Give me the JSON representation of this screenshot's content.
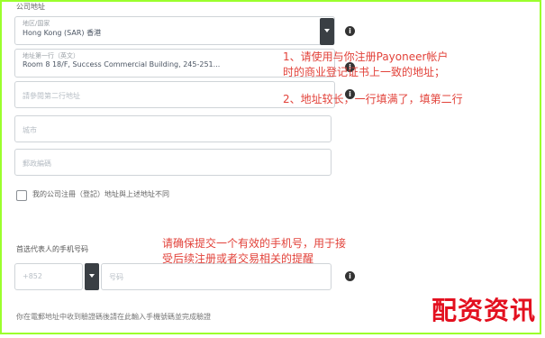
{
  "form": {
    "section_title": "公司地址",
    "region": {
      "label": "地区/国家",
      "value": "Hong Kong (SAR) 香港"
    },
    "address1": {
      "label": "地址第一行（英文）",
      "value": "Room 8 18/F, Success Commercial Building, 245-251..."
    },
    "address2": {
      "placeholder": "請參閱第二行地址"
    },
    "city": {
      "placeholder": "城市"
    },
    "postcode": {
      "placeholder": "郵政編碼"
    },
    "checkbox_label": "我的公司注冊（登記）地址與上述地址不同",
    "phone": {
      "label": "首选代表人的手机号码",
      "code": "+852",
      "placeholder": "号码"
    },
    "bottom_text": "你在電郵地址中收到驗證碼後請在此輸入手機號碼並完成驗證"
  },
  "notes": {
    "note1_line1": "1、请使用与你注册Payoneer帐户",
    "note1_line2": "时的商业登记证书上一致的地址；",
    "note2": "2、地址较长，一行填满了，填第二行",
    "note3_line1": "请确保提交一个有效的手机号，用于接",
    "note3_line2": "受后续注册或者交易相关的提醒"
  },
  "info_glyph": "i",
  "watermark": "配资资讯",
  "colors": {
    "note_red": "#e2423a",
    "watermark_red": "#e3101f",
    "frame_green": "#9bff2c"
  },
  "icons": {
    "dropdown": "chevron-down-icon",
    "info": "info-icon"
  }
}
